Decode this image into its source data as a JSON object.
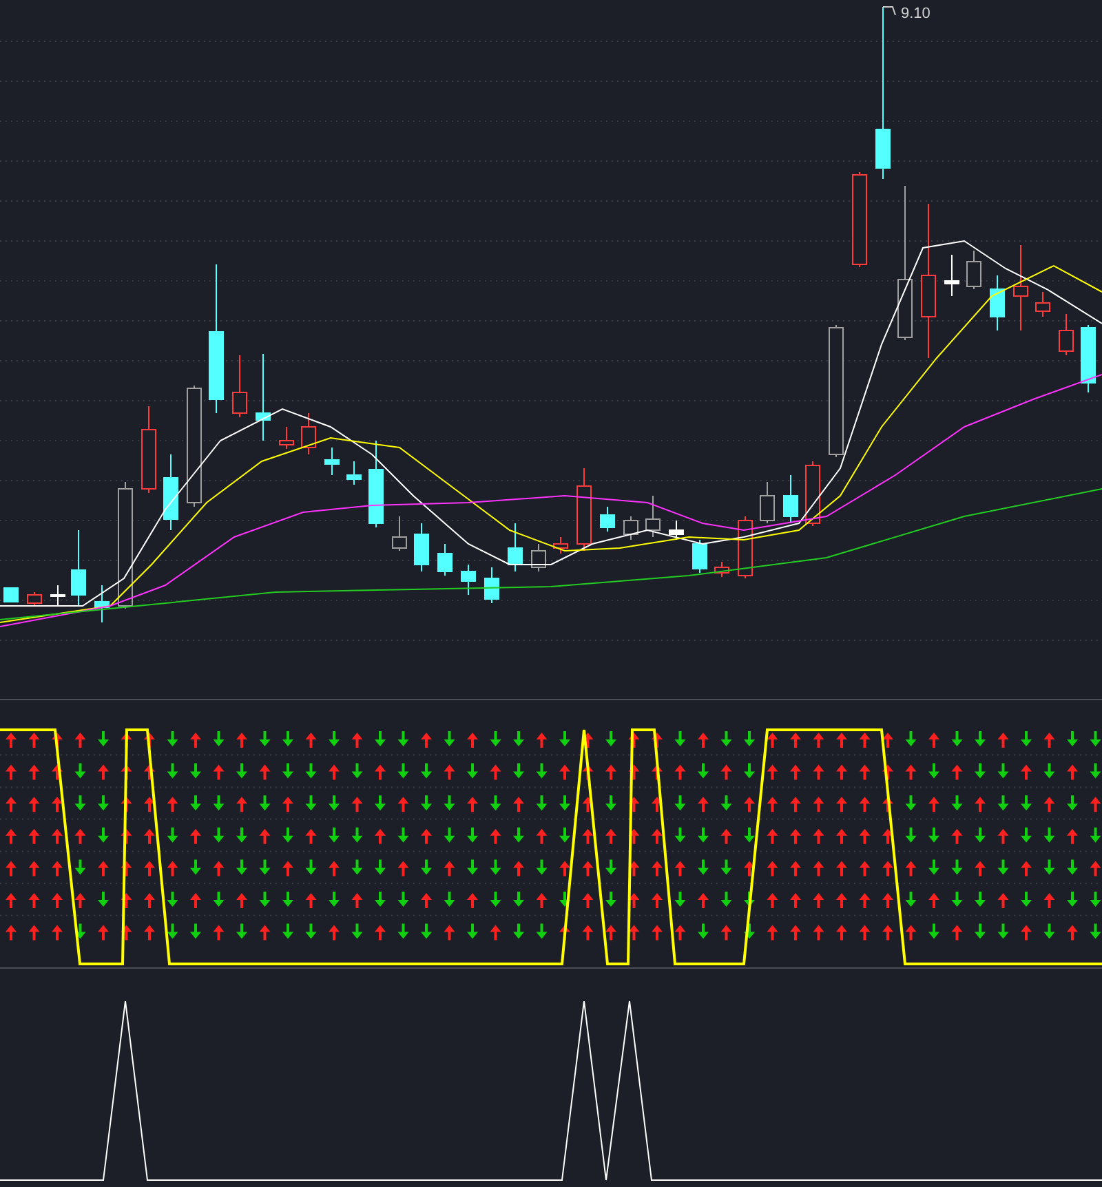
{
  "price_chart": {
    "high_label": "9.10"
  }
}
